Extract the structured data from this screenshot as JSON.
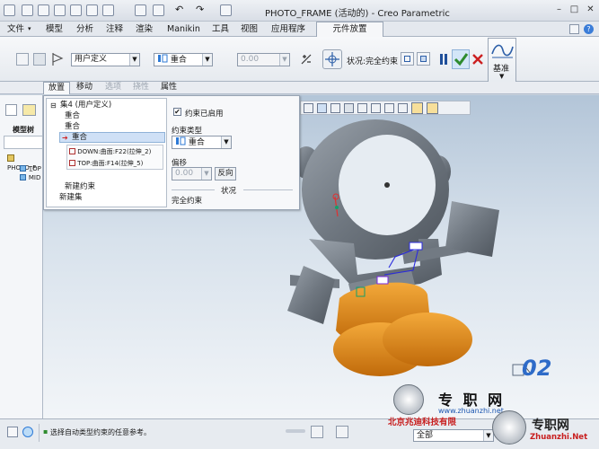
{
  "window": {
    "title": "PHOTO_FRAME (活动的) - Creo Parametric",
    "min": "–",
    "restore": "□",
    "close": "✕"
  },
  "menu": {
    "tabs": [
      "文件",
      "模型",
      "分析",
      "注释",
      "渲染",
      "Manikin",
      "工具",
      "视图",
      "应用程序"
    ],
    "file_arrow": "▾",
    "active_tab": "元件放置"
  },
  "ribbon": {
    "constraint_set": "用户定义",
    "constraint_type": "重合",
    "offset_value": "0.00",
    "status_label": "状况:完全约束",
    "basis_label": "基准"
  },
  "subtabs": [
    "放置",
    "移动",
    "选项",
    "挠性",
    "属性"
  ],
  "tree": {
    "label": "模型树",
    "items": [
      "PHOTO_F",
      "TOP",
      "MID"
    ]
  },
  "placement": {
    "set_title": "集4 (用户定义)",
    "items": [
      "重合",
      "重合"
    ],
    "selected": "重合",
    "ref1": "DOWN:曲面:F22(拉伸_2)",
    "ref2": "TOP:曲面:F14(拉伸_5)",
    "new_constraint": "新建约束",
    "new_set": "新建集",
    "enabled_label": "约束已启用",
    "type_label": "约束类型",
    "type_value": "重合",
    "offset_label": "偏移",
    "offset_value": "0.00",
    "flip_label": "反向",
    "status_title": "状况",
    "status_value": "完全约束"
  },
  "statusbar": {
    "message": "选择自动类型约束的任意参考。",
    "filter_value": "全部"
  },
  "watermark": {
    "brand": "专 职 网",
    "url": "www.zhuanzhi.net",
    "company": "北京兆迪科技有限",
    "brand2": "专职网",
    "brand2_url": "Zhuanzhi.Net",
    "number": "02"
  },
  "colors": {
    "accent_blue": "#1a5fb4",
    "model_gray": "#6f7780",
    "model_orange": "#e08a1c",
    "check_green": "#2e8b2e",
    "close_red": "#cc2020"
  }
}
